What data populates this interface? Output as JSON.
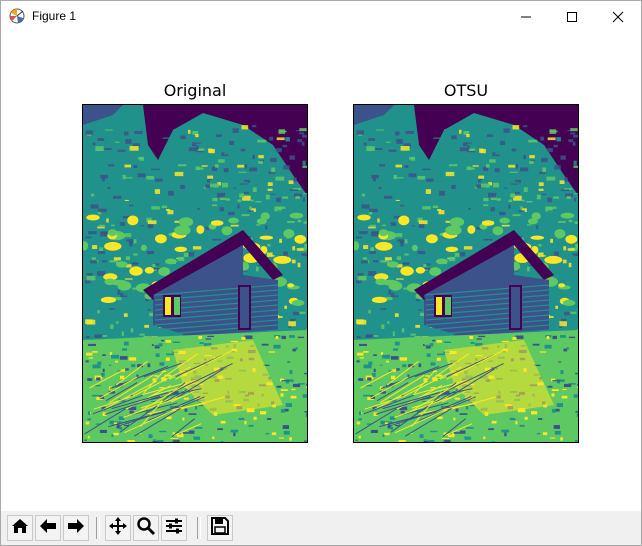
{
  "window": {
    "title": "Figure 1",
    "icons": {
      "app": "matplotlib-figure-icon",
      "minimize": "minimize-icon",
      "maximize": "maximize-icon",
      "close": "close-icon"
    }
  },
  "figure": {
    "axes": [
      {
        "title": "Original",
        "image": "grayscale cabin on rocky hillside rendered with viridis colormap"
      },
      {
        "title": "OTSU",
        "image": "grayscale cabin on rocky hillside rendered with viridis colormap"
      }
    ],
    "colormap": [
      "#440154",
      "#3b528b",
      "#21918c",
      "#5ec962",
      "#fde725"
    ]
  },
  "toolbar": {
    "buttons": [
      {
        "name": "home-button",
        "icon": "home-icon"
      },
      {
        "name": "back-button",
        "icon": "arrow-left-icon"
      },
      {
        "name": "forward-button",
        "icon": "arrow-right-icon"
      },
      {
        "name": "pan-button",
        "icon": "move-icon"
      },
      {
        "name": "zoom-button",
        "icon": "magnifier-icon"
      },
      {
        "name": "configure-subplots-button",
        "icon": "sliders-icon"
      },
      {
        "name": "save-button",
        "icon": "floppy-disk-icon"
      }
    ]
  }
}
